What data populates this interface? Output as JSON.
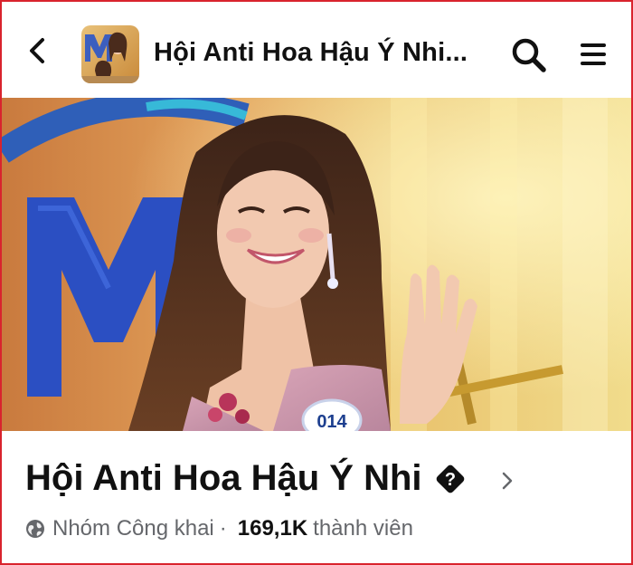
{
  "header": {
    "title": "Hội Anti Hoa Hậu Ý Nhi..."
  },
  "group": {
    "name": "Hội Anti Hoa Hậu Ý Nhi",
    "privacy": "Nhóm Công khai",
    "separator": "·",
    "members_count": "169,1K",
    "members_label": "thành viên"
  },
  "cover": {
    "contestant_number": "014"
  },
  "icons": {
    "back": "chevron-left-icon",
    "search": "search-icon",
    "menu": "hamburger-menu-icon",
    "badge": "question-diamond-icon",
    "globe": "globe-icon",
    "chevron": "chevron-right-icon"
  },
  "colors": {
    "frame_border": "#d9232d",
    "text_primary": "#111111",
    "text_secondary": "#65676b"
  }
}
